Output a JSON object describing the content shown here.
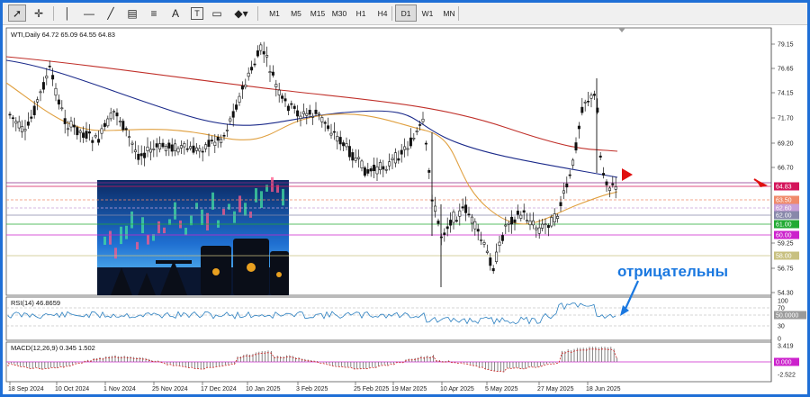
{
  "toolbar": {
    "timeframes": [
      "M1",
      "M5",
      "M15",
      "M30",
      "H1",
      "H4",
      "D1",
      "W1",
      "MN"
    ],
    "selected_timeframe": "D1",
    "tool_icons": [
      "cursor-arrow-icon",
      "crosshair-icon",
      "vertical-line-icon",
      "horizontal-line-icon",
      "trendline-icon",
      "parallel-channel-icon",
      "text-label-icon",
      "text-box-icon",
      "rectangle-label-icon",
      "shapes-dropdown-icon"
    ],
    "text_tool_label": "A",
    "textbox_tool_label": "T"
  },
  "main_chart": {
    "symbol_info": "WTI,Daily  64.72 65.09 64.55 64.83",
    "price_ticks": [
      "79.15",
      "76.65",
      "74.15",
      "71.70",
      "69.20",
      "66.70",
      "59.25",
      "56.75",
      "54.30"
    ],
    "level_badges": [
      {
        "label": "64.83",
        "color": "#d4145a"
      },
      {
        "label": "63.50",
        "color": "#f08a6a"
      },
      {
        "label": "62.60",
        "color": "#c8a0d8"
      },
      {
        "label": "62.00",
        "color": "#8888aa"
      },
      {
        "label": "61.00",
        "color": "#22aa33"
      },
      {
        "label": "60.00",
        "color": "#cc22cc"
      },
      {
        "label": "58.00",
        "color": "#c8c080"
      }
    ],
    "date_labels": [
      "18 Sep 2024",
      "10 Oct 2024",
      "1 Nov 2024",
      "25 Nov 2024",
      "17 Dec 2024",
      "10 Jan 2025",
      "3 Feb 2025",
      "25 Feb 2025",
      "19 Mar 2025",
      "10 Apr 2025",
      "5 May 2025",
      "27 May 2025",
      "18 Jun 2025"
    ],
    "annotation": "отрицательны",
    "colors": {
      "ma_long": "#c0302a",
      "ma_mid": "#1b2a8a",
      "ma_short": "#e0a040",
      "candles": "#111111",
      "arrow": "#e01010"
    }
  },
  "rsi": {
    "label": "RSI(14) 46.8659",
    "ticks": [
      "100",
      "70",
      "50.0000",
      "30",
      "0"
    ],
    "color": "#2a7fc0"
  },
  "macd": {
    "label": "MACD(12,26,9) 0.345 1.502",
    "ticks": [
      "3.419",
      "0.000",
      "-2.522"
    ],
    "signal_color": "#cc2222"
  }
}
